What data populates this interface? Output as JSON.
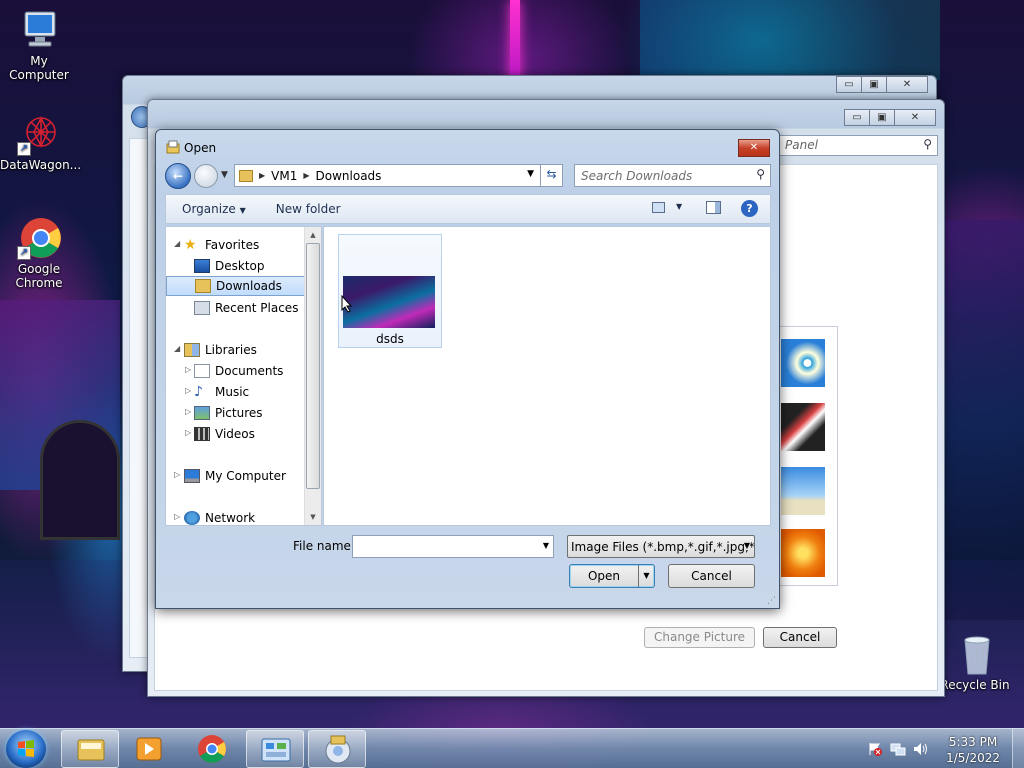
{
  "desktop": {
    "icons": [
      {
        "label": "My Computer"
      },
      {
        "label": "DataWagon..."
      },
      {
        "label": "Google Chrome"
      },
      {
        "label": "Recycle Bin"
      }
    ]
  },
  "background_window": {
    "search_placeholder": "Panel",
    "change_picture_label": "Change Picture",
    "cancel_label": "Cancel"
  },
  "dialog": {
    "title": "Open",
    "breadcrumb": [
      "VM1",
      "Downloads"
    ],
    "search_placeholder": "Search Downloads",
    "toolbar": {
      "organize_label": "Organize",
      "new_folder_label": "New folder"
    },
    "nav": {
      "favorites_label": "Favorites",
      "favorites": [
        "Desktop",
        "Downloads",
        "Recent Places"
      ],
      "selected": "Downloads",
      "libraries_label": "Libraries",
      "libraries": [
        "Documents",
        "Music",
        "Pictures",
        "Videos"
      ],
      "computer_label": "My Computer",
      "network_label": "Network"
    },
    "files": [
      {
        "name": "dsds"
      }
    ],
    "filename_label": "File name:",
    "filename_value": "",
    "filter_value": "Image Files (*.bmp,*.gif,*.jpg,*.",
    "open_label": "Open",
    "cancel_label": "Cancel"
  },
  "taskbar": {
    "time": "5:33 PM",
    "date": "1/5/2022"
  }
}
